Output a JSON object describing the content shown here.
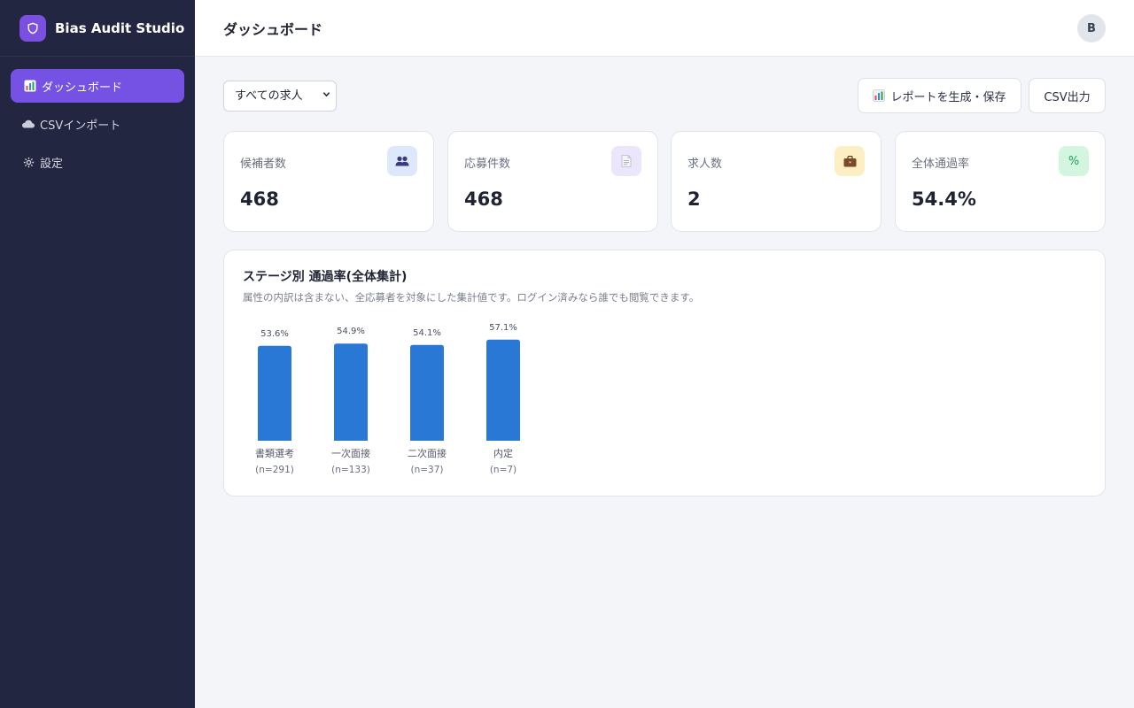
{
  "app": {
    "name": "Bias Audit Studio"
  },
  "sidebar": {
    "items": [
      {
        "label": "ダッシュボード",
        "icon": "bar-chart-icon",
        "active": true
      },
      {
        "label": "CSVインポート",
        "icon": "cloud-icon",
        "active": false
      },
      {
        "label": "設定",
        "icon": "gear-icon",
        "active": false
      }
    ]
  },
  "header": {
    "title": "ダッシュボード",
    "avatar": "B"
  },
  "toolbar": {
    "job_filter": {
      "selected": "すべての求人"
    },
    "report_button": "レポートを生成・保存",
    "csv_button": "CSV出力"
  },
  "stats": [
    {
      "label": "候補者数",
      "value": "468",
      "icon": "users-icon",
      "icon_bg": "#dde8fb"
    },
    {
      "label": "応募件数",
      "value": "468",
      "icon": "document-icon",
      "icon_bg": "#ebe6fb"
    },
    {
      "label": "求人数",
      "value": "2",
      "icon": "briefcase-icon",
      "icon_bg": "#fcefc3"
    },
    {
      "label": "全体通過率",
      "value": "54.4%",
      "icon": "percent-icon",
      "icon_bg": "#d4f6e0",
      "icon_text": "%"
    }
  ],
  "colors": {
    "sidebar_bg": "#222640",
    "accent": "#7552e3",
    "bar": "#2a78d6"
  },
  "chart": {
    "title": "ステージ別 通過率(全体集計)",
    "subtitle": "属性の内訳は含まない、全応募者を対象にした集計値です。ログイン済みなら誰でも閲覧できます。"
  },
  "chart_data": {
    "type": "bar",
    "categories": [
      "書類選考",
      "一次面接",
      "二次面接",
      "内定"
    ],
    "counts": [
      "(n=291)",
      "(n=133)",
      "(n=37)",
      "(n=7)"
    ],
    "values": [
      53.6,
      54.9,
      54.1,
      57.1
    ],
    "value_labels": [
      "53.6%",
      "54.9%",
      "54.1%",
      "57.1%"
    ],
    "ylim": [
      0,
      100
    ],
    "grid": false,
    "legend": "none"
  }
}
